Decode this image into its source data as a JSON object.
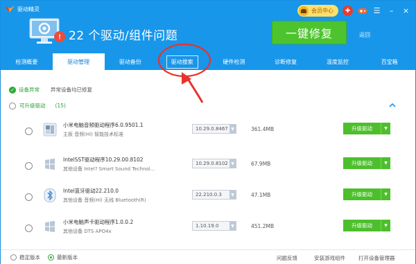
{
  "app": {
    "title": "驱动精灵",
    "vip_label": "会员中心"
  },
  "hero": {
    "title": "22 个驱动/组件问题",
    "fix_button": "一键修复",
    "back_link": "返回"
  },
  "tabs": [
    {
      "label": "检测概要",
      "active": false
    },
    {
      "label": "驱动管理",
      "active": true
    },
    {
      "label": "驱动备份",
      "active": false
    },
    {
      "label": "驱动搜索",
      "active": false,
      "boxed": true
    },
    {
      "label": "硬件检测",
      "active": false
    },
    {
      "label": "诊断修复",
      "active": false
    },
    {
      "label": "温度监控",
      "active": false
    },
    {
      "label": "百宝箱",
      "active": false
    }
  ],
  "status": {
    "label": "设备异常",
    "sub": "异常设备均已修复"
  },
  "group": {
    "label": "可升级驱动",
    "count": "(15)"
  },
  "drivers": [
    {
      "name": "小米电脑音频驱动程序6.0.9501.1",
      "desc": "主板   音频(Hi) 智能技术标准",
      "version": "10.29.0.8467",
      "size": "361.4MB",
      "button": "升级驱动",
      "icon": "audio-device-icon"
    },
    {
      "name": "IntelSST驱动程序10.29.00.8102",
      "desc": "其他设备   Intel? Smart Sound Technol...",
      "version": "10.29.0.8102",
      "size": "67.9MB",
      "button": "升级驱动",
      "icon": "windows-driver-icon"
    },
    {
      "name": "Intel蓝牙驱动22.210.0",
      "desc": "其他设备   音频(Hi) 无线 Bluetooth(R)",
      "version": "22.210.0.3",
      "size": "47.1MB",
      "button": "升级驱动",
      "icon": "bluetooth-icon"
    },
    {
      "name": "小米电脑声卡驱动程序1.0.0.2",
      "desc": "其他设备   DTS APO4x",
      "version": "1.10.19.0",
      "size": "451.2MB",
      "button": "升级驱动",
      "icon": "windows-driver-icon"
    }
  ],
  "footer": {
    "stable": "稳定版本",
    "latest": "最新版本",
    "feedback": "问题反馈",
    "install_game": "安装游戏组件",
    "open_device_mgr": "打开设备管理器"
  },
  "colors": {
    "header_blue": "#1896ea",
    "accent_green": "#4dc42e",
    "status_green": "#2c9f38",
    "annotation_red": "#e8332a"
  }
}
